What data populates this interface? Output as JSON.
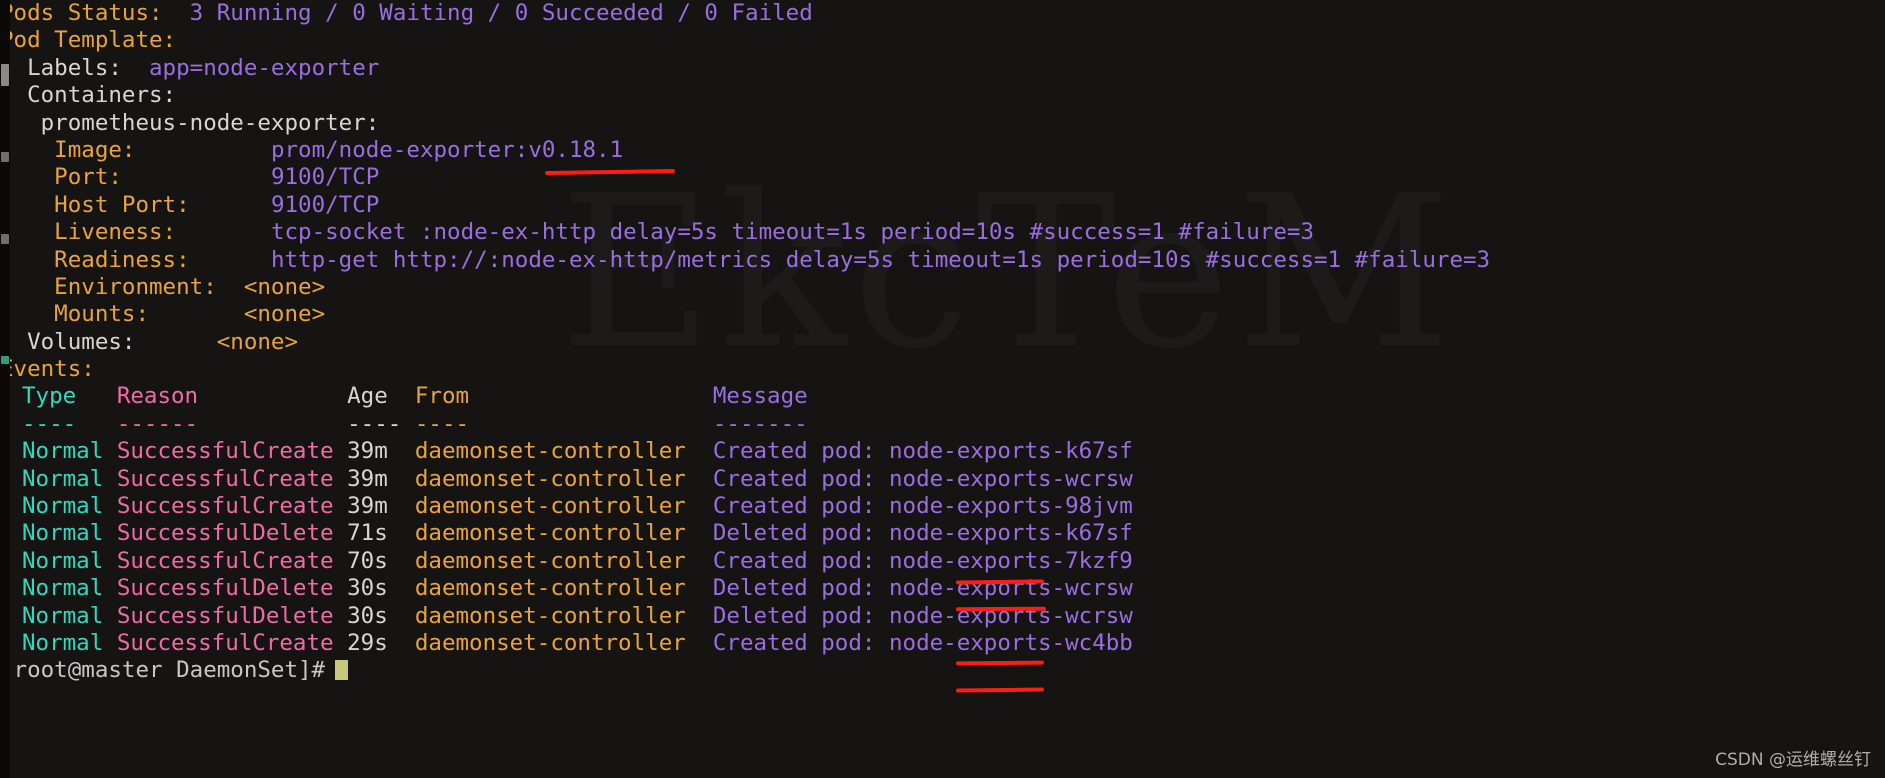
{
  "terminal": {
    "pods_status": {
      "label": "Pods Status:",
      "value": "  3 Running / 0 Waiting / 0 Succeeded / 0 Failed"
    },
    "pod_template_label": "Pod Template:",
    "labels": {
      "key": "  Labels:  ",
      "value": "app=node-exporter"
    },
    "containers_label": "  Containers:",
    "container_name": "   prometheus-node-exporter:",
    "fields": [
      {
        "key": "    Image:          ",
        "value": "prom/node-exporter:v0.18.1"
      },
      {
        "key": "    Port:           ",
        "value": "9100/TCP"
      },
      {
        "key": "    Host Port:      ",
        "value": "9100/TCP"
      },
      {
        "key": "    Liveness:       ",
        "value": "tcp-socket :node-ex-http delay=5s timeout=1s period=10s #success=1 #failure=3"
      },
      {
        "key": "    Readiness:      ",
        "value": "http-get http://:node-ex-http/metrics delay=5s timeout=1s period=10s #success=1 #failure=3"
      },
      {
        "key": "    Environment:  ",
        "value": "<none>"
      },
      {
        "key": "    Mounts:       ",
        "value": "<none>"
      }
    ],
    "volumes": {
      "key": "  Volumes:      ",
      "value": "<none>"
    },
    "events_label": "Events:",
    "events_table": {
      "columns": [
        {
          "name": "Type",
          "header": "Type",
          "dashes": "----",
          "color": "#2fd9c0"
        },
        {
          "name": "Reason",
          "header": "Reason",
          "dashes": "------",
          "color": "#ef6ba8"
        },
        {
          "name": "Age",
          "header": "Age",
          "dashes": "----",
          "color": "#d8d5d2"
        },
        {
          "name": "From",
          "header": "From",
          "dashes": "----",
          "color": "#e8a33d"
        },
        {
          "name": "Message",
          "header": "Message",
          "dashes": "-------",
          "color": "#9a6ee0"
        }
      ],
      "rows": [
        {
          "type": "Normal",
          "reason": "SuccessfulCreate",
          "age": "39m",
          "from": "daemonset-controller",
          "verb": "Created",
          "message_rest": " pod: node-exports-k67sf",
          "underlined": false
        },
        {
          "type": "Normal",
          "reason": "SuccessfulCreate",
          "age": "39m",
          "from": "daemonset-controller",
          "verb": "Created",
          "message_rest": " pod: node-exports-wcrsw",
          "underlined": false
        },
        {
          "type": "Normal",
          "reason": "SuccessfulCreate",
          "age": "39m",
          "from": "daemonset-controller",
          "verb": "Created",
          "message_rest": " pod: node-exports-98jvm",
          "underlined": false
        },
        {
          "type": "Normal",
          "reason": "SuccessfulDelete",
          "age": "71s",
          "from": "daemonset-controller",
          "verb": "Deleted",
          "message_rest": " pod: node-exports-k67sf",
          "underlined": false
        },
        {
          "type": "Normal",
          "reason": "SuccessfulCreate",
          "age": "70s",
          "from": "daemonset-controller",
          "verb": "Created",
          "message_rest": " pod: node-exports-7kzf9",
          "underlined": true
        },
        {
          "type": "Normal",
          "reason": "SuccessfulDelete",
          "age": "30s",
          "from": "daemonset-controller",
          "verb": "Deleted",
          "message_rest": " pod: node-exports-wcrsw",
          "underlined": true
        },
        {
          "type": "Normal",
          "reason": "SuccessfulDelete",
          "age": "30s",
          "from": "daemonset-controller",
          "verb": "Deleted",
          "message_rest": " pod: node-exports-wcrsw",
          "underlined": true
        },
        {
          "type": "Normal",
          "reason": "SuccessfulCreate",
          "age": "29s",
          "from": "daemonset-controller",
          "verb": "Created",
          "message_rest": " pod: node-exports-wc4bb",
          "underlined": true
        }
      ]
    },
    "prompt": "[root@master DaemonSet]#"
  },
  "annotations": {
    "underline_color": "#fb1d16",
    "underline_targets": [
      "v0.18.1",
      "Created",
      "Deleted",
      "Deleted",
      "Created"
    ]
  },
  "watermarks": {
    "background_text": "EkcTeM",
    "csdn": "CSDN @运维螺丝钉"
  },
  "colors": {
    "background": "#161412",
    "key_orange": "#e8a33d",
    "value_purple": "#9a6ee0",
    "white": "#d8d5d2",
    "cyan": "#2fd9c0",
    "pink": "#ef6ba8",
    "cursor": "#c8c77a"
  }
}
